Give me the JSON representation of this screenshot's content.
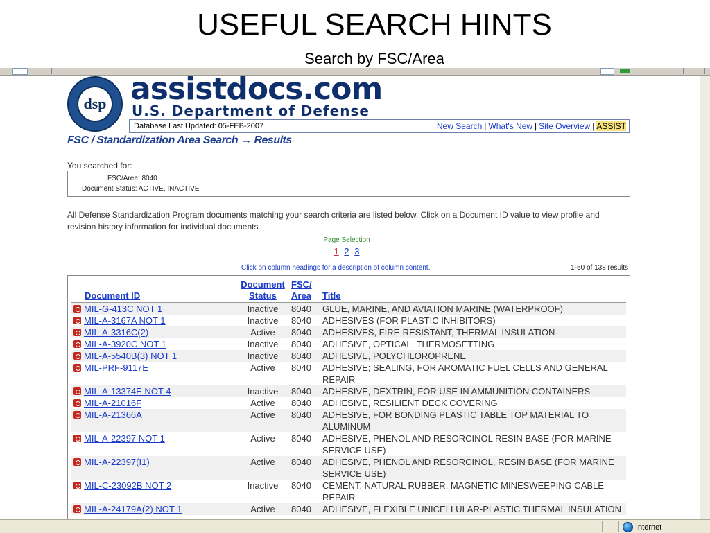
{
  "slide": {
    "title": "USEFUL SEARCH HINTS",
    "subtitle": "Search by FSC/Area"
  },
  "site": {
    "brand": "assistdocs.com",
    "department": "U.S. Department of Defense",
    "seal_letters": "dsp",
    "db_updated": "Database Last Updated: 05-FEB-2007",
    "links": [
      "New Search",
      "What's New",
      "Site Overview",
      "ASSIST"
    ],
    "results_heading": "FSC / Standardization Area Search → Results"
  },
  "search": {
    "label": "You searched for:",
    "fsc_area": "FSC/Area: 8040",
    "doc_status": "Document Status: ACTIVE, INACTIVE",
    "description": "All Defense Standardization Program documents matching your search criteria are listed below. Click on a Document ID value to view profile and revision history information for individual documents.",
    "page_selection_label": "Page Selection",
    "pages": [
      "1",
      "2",
      "3"
    ],
    "current_page": "1",
    "column_hint": "Click on column headings for a description of column content.",
    "result_count": "1-50 of 138 results"
  },
  "table": {
    "headers": {
      "doc_id": "Document ID",
      "status_line1": "Document",
      "status_line2": "Status",
      "fsc_line1": "FSC/",
      "fsc_line2": "Area",
      "title": "Title"
    },
    "rows": [
      {
        "id": "MIL-G-413C NOT 1",
        "status": "Inactive",
        "fsc": "8040",
        "title": "GLUE, MARINE, AND AVIATION MARINE (WATERPROOF)"
      },
      {
        "id": "MIL-A-3167A NOT 1",
        "status": "Inactive",
        "fsc": "8040",
        "title": "ADHESIVES (FOR PLASTIC INHIBITORS)"
      },
      {
        "id": "MIL-A-3316C(2)",
        "status": "Active",
        "fsc": "8040",
        "title": "ADHESIVES, FIRE-RESISTANT, THERMAL INSULATION"
      },
      {
        "id": "MIL-A-3920C NOT 1",
        "status": "Inactive",
        "fsc": "8040",
        "title": "ADHESIVE, OPTICAL, THERMOSETTING"
      },
      {
        "id": "MIL-A-5540B(3) NOT 1",
        "status": "Inactive",
        "fsc": "8040",
        "title": "ADHESIVE, POLYCHLOROPRENE"
      },
      {
        "id": "MIL-PRF-9117E",
        "status": "Active",
        "fsc": "8040",
        "title": "ADHESIVE; SEALING, FOR AROMATIC FUEL CELLS AND GENERAL REPAIR"
      },
      {
        "id": "MIL-A-13374E NOT 4",
        "status": "Inactive",
        "fsc": "8040",
        "title": "ADHESIVE, DEXTRIN, FOR USE IN AMMUNITION CONTAINERS"
      },
      {
        "id": "MIL-A-21016F",
        "status": "Active",
        "fsc": "8040",
        "title": "ADHESIVE, RESILIENT DECK COVERING"
      },
      {
        "id": "MIL-A-21366A",
        "status": "Active",
        "fsc": "8040",
        "title": "ADHESIVE, FOR BONDING PLASTIC TABLE TOP MATERIAL TO ALUMINUM"
      },
      {
        "id": "MIL-A-22397 NOT 1",
        "status": "Active",
        "fsc": "8040",
        "title": "ADHESIVE, PHENOL AND RESORCINOL RESIN BASE (FOR MARINE SERVICE USE)"
      },
      {
        "id": "MIL-A-22397(I1)",
        "status": "Active",
        "fsc": "8040",
        "title": "ADHESIVE, PHENOL AND RESORCINOL, RESIN BASE (FOR MARINE SERVICE USE)"
      },
      {
        "id": "MIL-C-23092B NOT 2",
        "status": "Inactive",
        "fsc": "8040",
        "title": "CEMENT, NATURAL RUBBER; MAGNETIC MINESWEEPING CABLE REPAIR"
      },
      {
        "id": "MIL-A-24179A(2) NOT 1",
        "status": "Active",
        "fsc": "8040",
        "title": "ADHESIVE, FLEXIBLE UNICELLULAR-PLASTIC THERMAL INSULATION"
      }
    ]
  },
  "statusbar": {
    "zone": "Internet",
    "zone_icon": "globe-icon"
  },
  "colors": {
    "link": "#1a3cc8",
    "brand": "#0f2e6c",
    "current_page": "#d12b2b",
    "page_selection": "#2c8a2c"
  }
}
